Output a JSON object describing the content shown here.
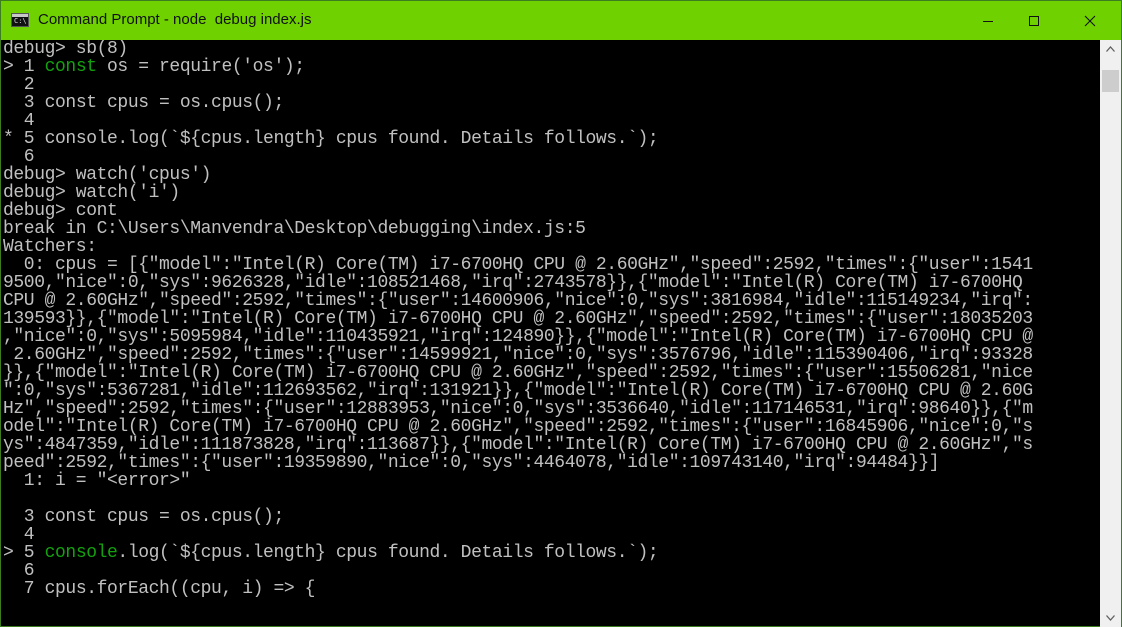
{
  "window": {
    "title": "Command Prompt - node  debug index.js",
    "icon": "cmd-icon",
    "icon_text": "C:\\",
    "controls": [
      "minimize-icon",
      "maximize-icon",
      "close-icon"
    ]
  },
  "colors": {
    "titlebar": "#6fd200",
    "console_bg": "#000000",
    "console_text": "#c0c0c0",
    "keyword_green": "#13a10e"
  },
  "console": {
    "lines": [
      {
        "prefix": "",
        "text": "debug> sb(8)"
      },
      {
        "prefix": "> 1 ",
        "green": "const",
        "text": " os = require('os');"
      },
      {
        "prefix": "  2",
        "text": ""
      },
      {
        "prefix": "  3 ",
        "text": "const cpus = os.cpus();"
      },
      {
        "prefix": "  4",
        "text": ""
      },
      {
        "prefix": "* 5 ",
        "text": "console.log(`${cpus.length} cpus found. Details follows.`);"
      },
      {
        "prefix": "  6",
        "text": ""
      },
      {
        "prefix": "",
        "text": "debug> watch('cpus')"
      },
      {
        "prefix": "",
        "text": "debug> watch('i')"
      },
      {
        "prefix": "",
        "text": "debug> cont"
      },
      {
        "prefix": "",
        "text": "break in C:\\Users\\Manvendra\\Desktop\\debugging\\index.js:5"
      },
      {
        "prefix": "",
        "text": "Watchers:"
      },
      {
        "prefix": "",
        "text": "  0: cpus = [{\"model\":\"Intel(R) Core(TM) i7-6700HQ CPU @ 2.60GHz\",\"speed\":2592,\"times\":{\"user\":1541"
      },
      {
        "prefix": "",
        "text": "9500,\"nice\":0,\"sys\":9626328,\"idle\":108521468,\"irq\":2743578}},{\"model\":\"Intel(R) Core(TM) i7-6700HQ"
      },
      {
        "prefix": "",
        "text": "CPU @ 2.60GHz\",\"speed\":2592,\"times\":{\"user\":14600906,\"nice\":0,\"sys\":3816984,\"idle\":115149234,\"irq\":"
      },
      {
        "prefix": "",
        "text": "139593}},{\"model\":\"Intel(R) Core(TM) i7-6700HQ CPU @ 2.60GHz\",\"speed\":2592,\"times\":{\"user\":18035203"
      },
      {
        "prefix": "",
        "text": ",\"nice\":0,\"sys\":5095984,\"idle\":110435921,\"irq\":124890}},{\"model\":\"Intel(R) Core(TM) i7-6700HQ CPU @"
      },
      {
        "prefix": "",
        "text": " 2.60GHz\",\"speed\":2592,\"times\":{\"user\":14599921,\"nice\":0,\"sys\":3576796,\"idle\":115390406,\"irq\":93328"
      },
      {
        "prefix": "",
        "text": "}},{\"model\":\"Intel(R) Core(TM) i7-6700HQ CPU @ 2.60GHz\",\"speed\":2592,\"times\":{\"user\":15506281,\"nice"
      },
      {
        "prefix": "",
        "text": "\":0,\"sys\":5367281,\"idle\":112693562,\"irq\":131921}},{\"model\":\"Intel(R) Core(TM) i7-6700HQ CPU @ 2.60G"
      },
      {
        "prefix": "",
        "text": "Hz\",\"speed\":2592,\"times\":{\"user\":12883953,\"nice\":0,\"sys\":3536640,\"idle\":117146531,\"irq\":98640}},{\"m"
      },
      {
        "prefix": "",
        "text": "odel\":\"Intel(R) Core(TM) i7-6700HQ CPU @ 2.60GHz\",\"speed\":2592,\"times\":{\"user\":16845906,\"nice\":0,\"s"
      },
      {
        "prefix": "",
        "text": "ys\":4847359,\"idle\":111873828,\"irq\":113687}},{\"model\":\"Intel(R) Core(TM) i7-6700HQ CPU @ 2.60GHz\",\"s"
      },
      {
        "prefix": "",
        "text": "peed\":2592,\"times\":{\"user\":19359890,\"nice\":0,\"sys\":4464078,\"idle\":109743140,\"irq\":94484}}]"
      },
      {
        "prefix": "",
        "text": "  1: i = \"<error>\""
      },
      {
        "prefix": "",
        "text": ""
      },
      {
        "prefix": "  3 ",
        "text": "const cpus = os.cpus();"
      },
      {
        "prefix": "  4",
        "text": ""
      },
      {
        "prefix": "> 5 ",
        "green": "console",
        "text": ".log(`${cpus.length} cpus found. Details follows.`);"
      },
      {
        "prefix": "  6",
        "text": ""
      },
      {
        "prefix": "  7 ",
        "text": "cpus.forEach((cpu, i) => {"
      }
    ]
  },
  "scrollbar": {
    "up_icon": "scroll-up-arrow-icon",
    "down_icon": "scroll-down-arrow-icon"
  }
}
